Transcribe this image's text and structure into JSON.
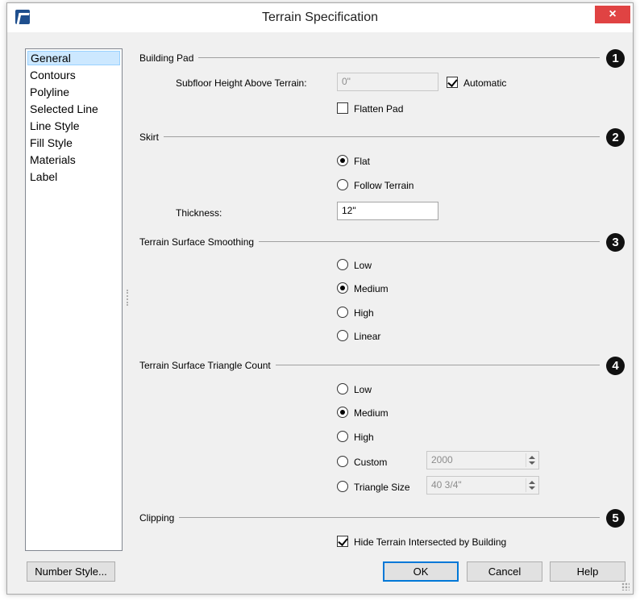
{
  "window": {
    "title": "Terrain Specification",
    "close_glyph": "×"
  },
  "sidebar": {
    "items": [
      {
        "label": "General",
        "selected": true
      },
      {
        "label": "Contours"
      },
      {
        "label": "Polyline"
      },
      {
        "label": "Selected Line"
      },
      {
        "label": "Line Style"
      },
      {
        "label": "Fill Style"
      },
      {
        "label": "Materials"
      },
      {
        "label": "Label"
      }
    ]
  },
  "building_pad": {
    "title": "Building Pad",
    "badge": "1",
    "subfloor_label": "Subfloor Height Above Terrain:",
    "subfloor_value": "0\"",
    "automatic_label": "Automatic",
    "automatic_checked": true,
    "flatten_label": "Flatten Pad",
    "flatten_checked": false
  },
  "skirt": {
    "title": "Skirt",
    "badge": "2",
    "options": [
      {
        "label": "Flat",
        "checked": true
      },
      {
        "label": "Follow Terrain",
        "checked": false
      }
    ],
    "thickness_label": "Thickness:",
    "thickness_value": "12\""
  },
  "smoothing": {
    "title": "Terrain Surface Smoothing",
    "badge": "3",
    "options": [
      {
        "label": "Low",
        "checked": false
      },
      {
        "label": "Medium",
        "checked": true
      },
      {
        "label": "High",
        "checked": false
      },
      {
        "label": "Linear",
        "checked": false
      }
    ]
  },
  "triangle_count": {
    "title": "Terrain Surface Triangle Count",
    "badge": "4",
    "options": [
      {
        "label": "Low",
        "checked": false
      },
      {
        "label": "Medium",
        "checked": true
      },
      {
        "label": "High",
        "checked": false
      },
      {
        "label": "Custom",
        "checked": false
      },
      {
        "label": "Triangle Size",
        "checked": false
      }
    ],
    "custom_value": "2000",
    "triangle_size_value": "40 3/4\""
  },
  "clipping": {
    "title": "Clipping",
    "badge": "5",
    "hide_label": "Hide Terrain Intersected by Building",
    "hide_checked": true
  },
  "buttons": {
    "number_style": "Number Style...",
    "ok": "OK",
    "cancel": "Cancel",
    "help": "Help"
  },
  "colors": {
    "close_button": "#e04343",
    "selection": "#cce8ff",
    "default_button_border": "#0078d7"
  }
}
